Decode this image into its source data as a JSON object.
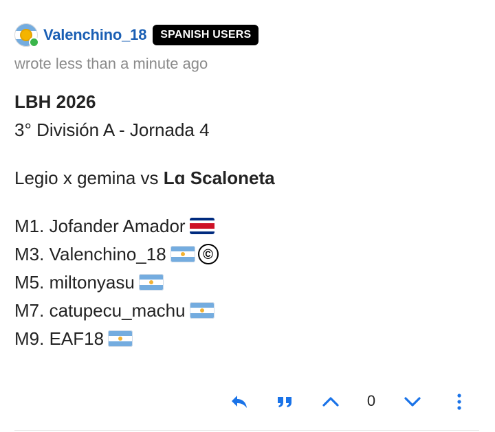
{
  "post": {
    "author": {
      "username": "Valenchino_18",
      "group_badge": "SPANISH USERS",
      "online": true
    },
    "meta": "wrote less than a minute ago",
    "content": {
      "title": "LBH 2026",
      "subtitle": "3° División A - Jornada 4",
      "match_prefix": "Legio x gemina vs ",
      "match_opponent": "Lɑ Scaloneta",
      "players": [
        {
          "label": "M1. Jofander Amador",
          "flag": "costa-rica"
        },
        {
          "label": "M3. Valenchino_18",
          "flag": "argentina",
          "extra": "©"
        },
        {
          "label": "M5. miltonyasu",
          "flag": "argentina"
        },
        {
          "label": "M7. catupecu_machu",
          "flag": "argentina"
        },
        {
          "label": "M9. EAF18",
          "flag": "argentina"
        }
      ]
    },
    "actions": {
      "reply_icon": "reply-icon",
      "quote_icon": "quote-icon",
      "upvote_icon": "chevron-up-icon",
      "vote_count": "0",
      "downvote_icon": "chevron-down-icon",
      "more_icon": "kebab-menu-icon"
    },
    "colors": {
      "username": "#1a5fb4",
      "action_icons": "#1a73e8",
      "badge_bg": "#000000",
      "online": "#3ab54a"
    }
  }
}
